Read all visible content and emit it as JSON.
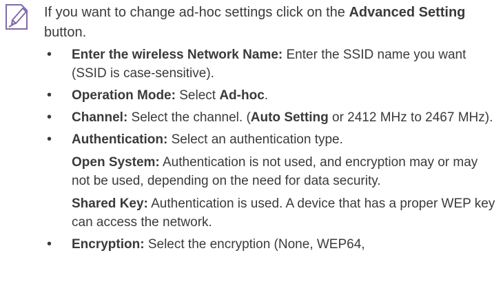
{
  "note": {
    "icon": "note-pencil-icon",
    "intro_pre": "If you want to change ad-hoc settings click on the ",
    "intro_bold": "Advanced Setting",
    "intro_post": " button."
  },
  "items": [
    {
      "label": "Enter the wireless Network Name:",
      "text": " Enter the SSID name you want (SSID is case-sensitive)."
    },
    {
      "label": "Operation Mode:",
      "text": " Select ",
      "bold_value": "Ad-hoc",
      "text_end": "."
    },
    {
      "label": "Channel:",
      "text": " Select the channel. (",
      "bold_value": "Auto Setting",
      "text_end": " or 2412 MHz to 2467 MHz)."
    },
    {
      "label": "Authentication:",
      "text": " Select an authentication type.",
      "subs": [
        {
          "label": "Open System:",
          "text": " Authentication is not used, and encryption may or may not be used, depending on the need for data security."
        },
        {
          "label": "Shared Key:",
          "text": " Authentication is used. A device that has a proper WEP key can access the network."
        }
      ]
    },
    {
      "label": "Encryption:",
      "text": " Select the encryption (None, WEP64,"
    }
  ]
}
